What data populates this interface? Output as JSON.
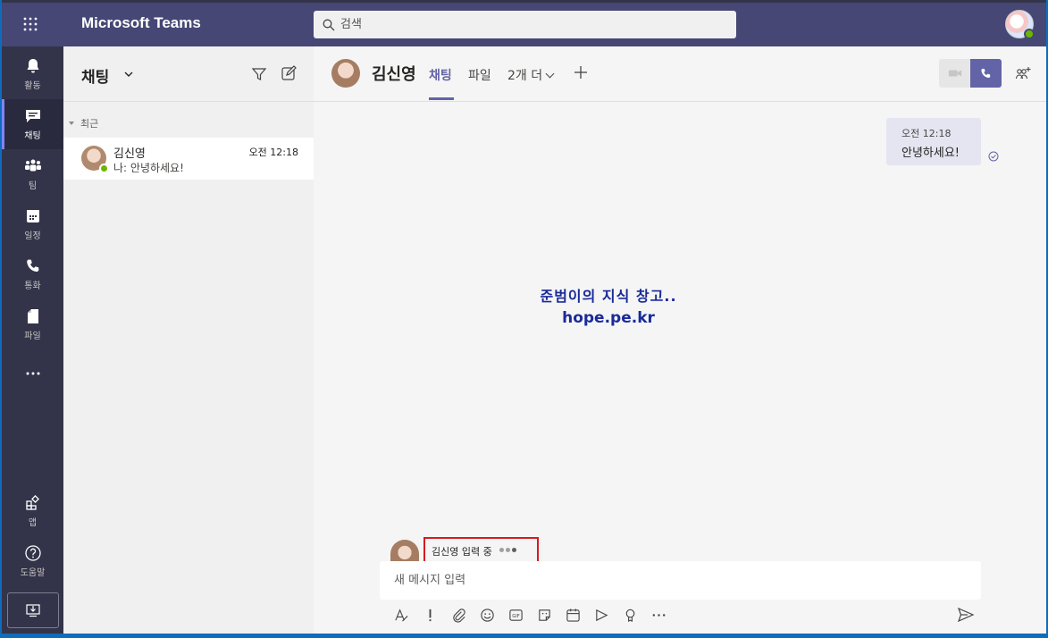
{
  "app": {
    "title": "Microsoft Teams"
  },
  "search": {
    "placeholder": "검색"
  },
  "rail": {
    "items": [
      {
        "label": "활동",
        "icon": "bell-icon"
      },
      {
        "label": "채팅",
        "icon": "chat-icon",
        "active": true
      },
      {
        "label": "팀",
        "icon": "teams-icon"
      },
      {
        "label": "일정",
        "icon": "calendar-icon"
      },
      {
        "label": "통화",
        "icon": "phone-icon"
      },
      {
        "label": "파일",
        "icon": "file-icon"
      },
      {
        "label": "",
        "icon": "more-icon"
      }
    ],
    "bottom": [
      {
        "label": "앱",
        "icon": "apps-icon"
      },
      {
        "label": "도움말",
        "icon": "help-icon"
      }
    ]
  },
  "chat_list": {
    "title": "채팅",
    "section": "최근",
    "items": [
      {
        "name": "김신영",
        "time": "오전 12:18",
        "preview": "나: 안녕하세요!",
        "presence": "available"
      }
    ]
  },
  "conversation": {
    "contact_name": "김신영",
    "tabs": [
      {
        "label": "채팅",
        "active": true
      },
      {
        "label": "파일"
      },
      {
        "label": "2개 더"
      }
    ],
    "messages": [
      {
        "time": "오전 12:18",
        "text": "안녕하세요!",
        "from": "me"
      }
    ],
    "watermark": {
      "line1": "준범이의 지식 창고..",
      "line2": "hope.pe.kr"
    },
    "typing_indicator": "김신영 입력 중",
    "compose_placeholder": "새 메시지 입력"
  },
  "colors": {
    "header_bg": "#464775",
    "rail_bg": "#33344a",
    "accent": "#6264a7",
    "presence": "#6bb700",
    "highlight_border": "#d71920"
  }
}
